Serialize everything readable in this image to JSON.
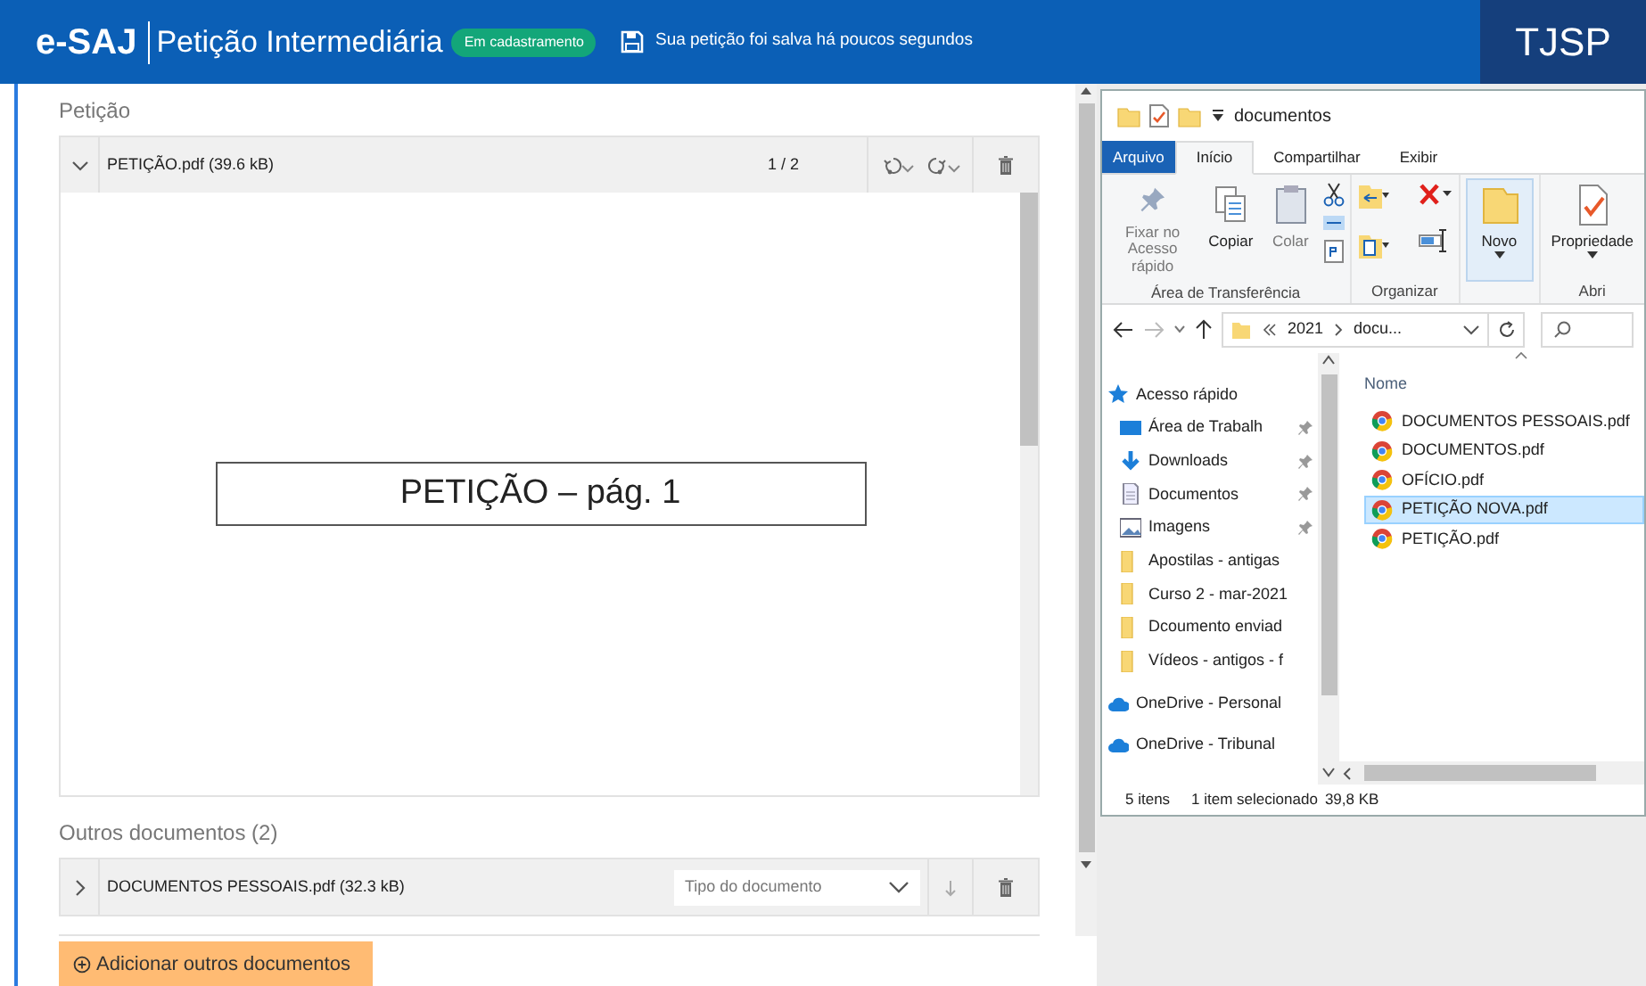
{
  "header": {
    "brand": "e-SAJ",
    "title": "Petição Intermediária",
    "status_badge": "Em cadastramento",
    "save_message": "Sua petição foi salva há poucos segundos",
    "logo": "TJSP"
  },
  "petition": {
    "section_title": "Petição",
    "file": {
      "name": "PETIÇÃO.pdf (39.6 kB)",
      "expanded": true,
      "pages": "1 / 2",
      "preview_text": "PETIÇÃO – pág. 1"
    }
  },
  "other_documents": {
    "section_title": "Outros documentos (2)",
    "items": [
      {
        "name": "DOCUMENTOS PESSOAIS.pdf (32.3 kB)",
        "expanded": false,
        "type_placeholder": "Tipo do documento"
      }
    ]
  },
  "add_button": "Adicionar outros documentos",
  "explorer": {
    "title": "documentos",
    "tabs": [
      {
        "label": "Arquivo",
        "kind": "file",
        "selected": false
      },
      {
        "label": "Início",
        "kind": "tab",
        "selected": true
      },
      {
        "label": "Compartilhar",
        "kind": "tab",
        "selected": false
      },
      {
        "label": "Exibir",
        "kind": "tab",
        "selected": false
      }
    ],
    "ribbon_groups": [
      {
        "label": "Área de Transferência",
        "buttons": [
          {
            "label": "Fixar no Acesso rápido",
            "kind": "pin",
            "disabled": true,
            "highlighted": false
          },
          {
            "label": "Copiar",
            "kind": "copy",
            "disabled": false,
            "highlighted": false
          },
          {
            "label": "Colar",
            "kind": "paste",
            "disabled": true,
            "highlighted": false
          }
        ],
        "kind": "clipboard"
      },
      {
        "label": "Organizar",
        "kind": "organize"
      },
      {
        "buttons": [
          {
            "label": "Novo",
            "kind": "new-folder",
            "disabled": false,
            "highlighted": true
          }
        ]
      },
      {
        "label": "Abri",
        "buttons": [
          {
            "label": "Propriedade",
            "kind": "properties",
            "disabled": false,
            "highlighted": false
          }
        ]
      }
    ],
    "address": {
      "segments": [
        "2021",
        "docu..."
      ]
    },
    "nav": [
      {
        "label": "Acesso rápido",
        "kind": "star",
        "pinned": false
      },
      {
        "label": "Área de Trabalh",
        "kind": "desktop",
        "pinned": true
      },
      {
        "label": "Downloads",
        "kind": "downloads",
        "pinned": true
      },
      {
        "label": "Documentos",
        "kind": "documents",
        "pinned": true
      },
      {
        "label": "Imagens",
        "kind": "pictures",
        "pinned": true
      },
      {
        "label": "Apostilas - antigas",
        "kind": "folder",
        "pinned": false
      },
      {
        "label": "Curso 2 - mar-2021",
        "kind": "folder",
        "pinned": false
      },
      {
        "label": "Dcoumento enviad",
        "kind": "folder",
        "pinned": false
      },
      {
        "label": "Vídeos - antigos - f",
        "kind": "folder",
        "pinned": false
      },
      {
        "label": "OneDrive - Personal",
        "kind": "cloud",
        "pinned": false
      },
      {
        "label": "OneDrive - Tribunal",
        "kind": "cloud",
        "pinned": false
      }
    ],
    "column_header": "Nome",
    "files": [
      {
        "name": "DOCUMENTOS PESSOAIS.pdf",
        "selected": false
      },
      {
        "name": "DOCUMENTOS.pdf",
        "selected": false
      },
      {
        "name": "OFÍCIO.pdf",
        "selected": false
      },
      {
        "name": "PETIÇÃO NOVA.pdf",
        "selected": true
      },
      {
        "name": "PETIÇÃO.pdf",
        "selected": false
      }
    ],
    "status": {
      "count": "5 itens",
      "selection": "1 item selecionado",
      "size": "39,8 KB"
    }
  }
}
